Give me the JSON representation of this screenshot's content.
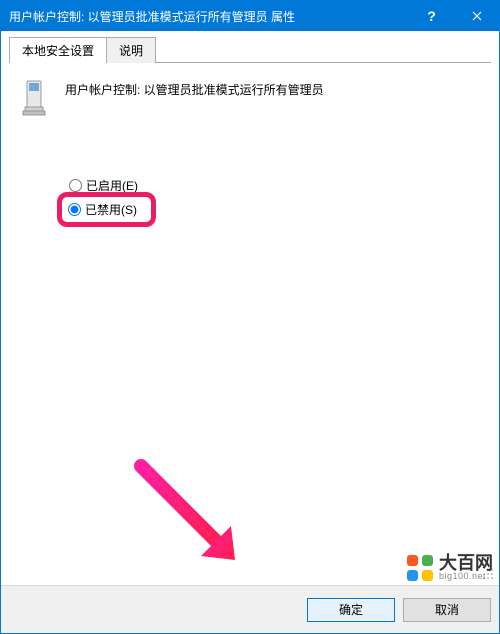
{
  "window": {
    "title": "用户帐户控制: 以管理员批准模式运行所有管理员 属性"
  },
  "tabs": {
    "local": "本地安全设置",
    "explain": "说明"
  },
  "policy": {
    "description": "用户帐户控制: 以管理员批准模式运行所有管理员"
  },
  "options": {
    "enabled": "已启用(E)",
    "disabled": "已禁用(S)"
  },
  "buttons": {
    "ok": "确定",
    "cancel": "取消"
  },
  "watermark": {
    "name": "大百网",
    "domain": "big100.net"
  },
  "icons": {
    "help": "?",
    "close": "close"
  }
}
